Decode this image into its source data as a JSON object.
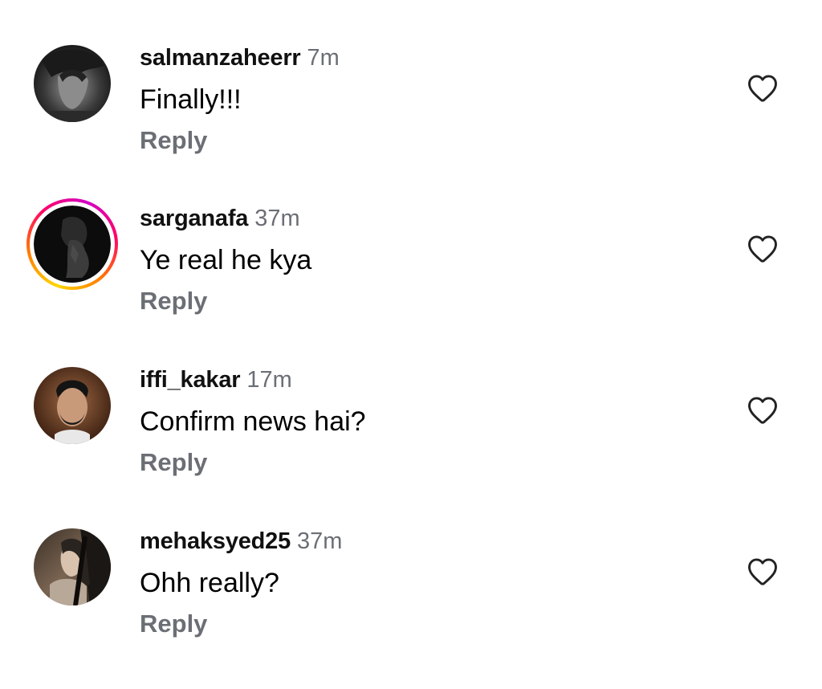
{
  "comments": [
    {
      "username": "salmanzaheerr",
      "time": "7m",
      "text": "Finally!!!",
      "reply_label": "Reply",
      "avatar_icon": "profile-photo",
      "story_ring": false,
      "like_icon": "heart-outline-icon"
    },
    {
      "username": "sarganafa",
      "time": "37m",
      "text": "Ye real he kya",
      "reply_label": "Reply",
      "avatar_icon": "profile-photo",
      "story_ring": true,
      "like_icon": "heart-outline-icon"
    },
    {
      "username": "iffi_kakar",
      "time": "17m",
      "text": "Confirm news hai?",
      "reply_label": "Reply",
      "avatar_icon": "profile-photo",
      "story_ring": false,
      "like_icon": "heart-outline-icon"
    },
    {
      "username": "mehaksyed25",
      "time": "37m",
      "text": "Ohh really?",
      "reply_label": "Reply",
      "avatar_icon": "profile-photo",
      "story_ring": false,
      "like_icon": "heart-outline-icon"
    }
  ],
  "colors": {
    "username": "#111111",
    "meta": "#6b6f75",
    "text": "#000000",
    "story_ring": [
      "#ffd600",
      "#ff7a00",
      "#ff0169",
      "#d300c5"
    ]
  }
}
